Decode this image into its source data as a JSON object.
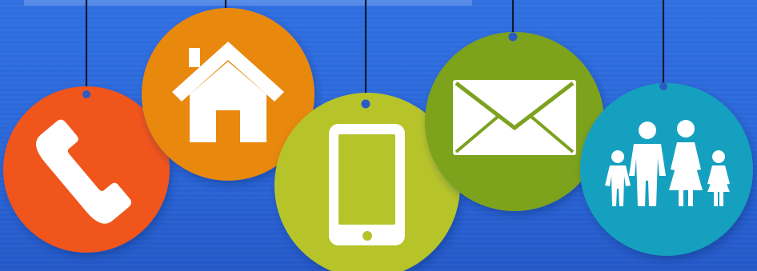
{
  "background_color": "#2a66d8",
  "tags": [
    {
      "id": "phone",
      "icon": "phone-handset-icon",
      "color": "#f0541a"
    },
    {
      "id": "home",
      "icon": "house-icon",
      "color": "#e8880a"
    },
    {
      "id": "mobile",
      "icon": "smartphone-icon",
      "color": "#b6c42b"
    },
    {
      "id": "email",
      "icon": "envelope-icon",
      "color": "#7da21f"
    },
    {
      "id": "family",
      "icon": "family-icon",
      "color": "#17a0bf"
    }
  ]
}
